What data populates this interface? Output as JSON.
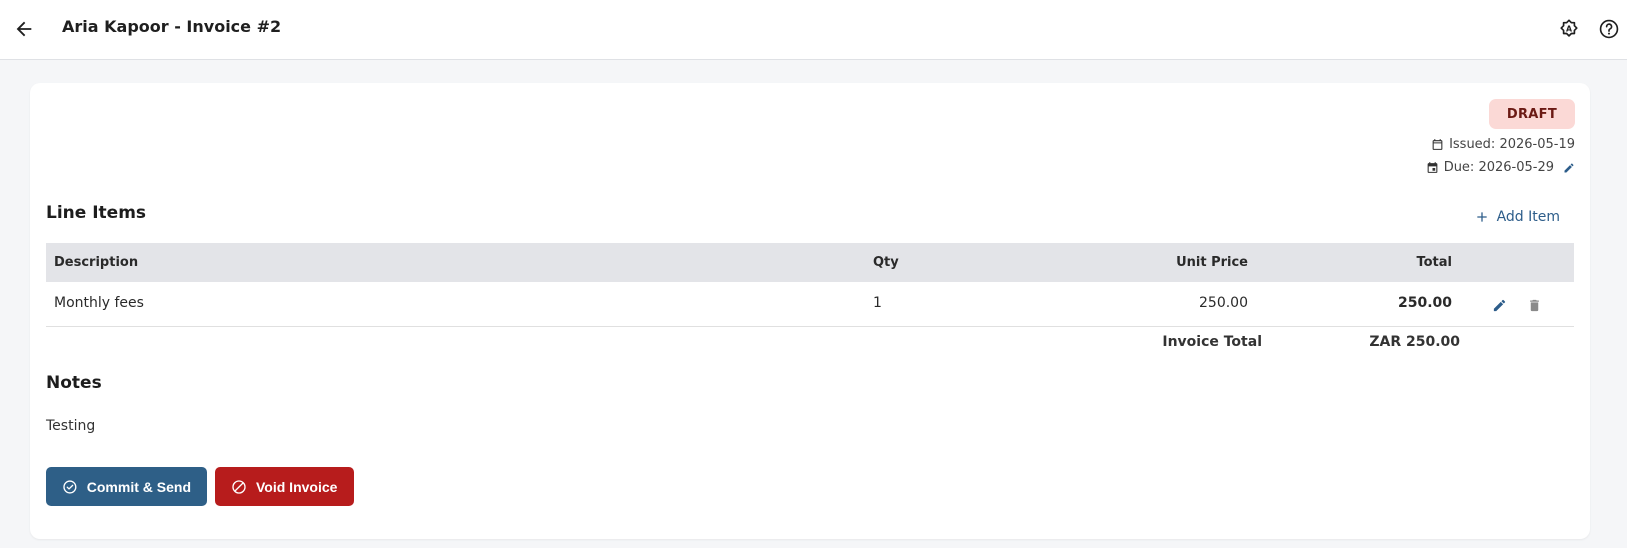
{
  "header": {
    "title": "Aria Kapoor - Invoice #2",
    "back_icon": "arrow-left-icon",
    "theme_icon": "auto-brightness-icon",
    "help_icon": "help-circle-icon"
  },
  "invoice": {
    "status": "DRAFT",
    "status_color": "#fbd9d6",
    "issued": "Issued: 2026-05-19",
    "due": "Due: 2026-05-29"
  },
  "line_items": {
    "title": "Line Items",
    "add_label": "Add Item",
    "columns": [
      "Description",
      "Qty",
      "Unit Price",
      "Total"
    ],
    "rows": [
      {
        "description": "Monthly fees",
        "qty": "1",
        "unit_price": "250.00",
        "total": "250.00"
      }
    ],
    "total_label": "Invoice Total",
    "total_value": "ZAR 250.00"
  },
  "notes": {
    "title": "Notes",
    "text": "Testing"
  },
  "actions": {
    "commit_label": "Commit & Send",
    "void_label": "Void Invoice",
    "commit_color": "#2e5f87",
    "void_color": "#b71c1c"
  }
}
